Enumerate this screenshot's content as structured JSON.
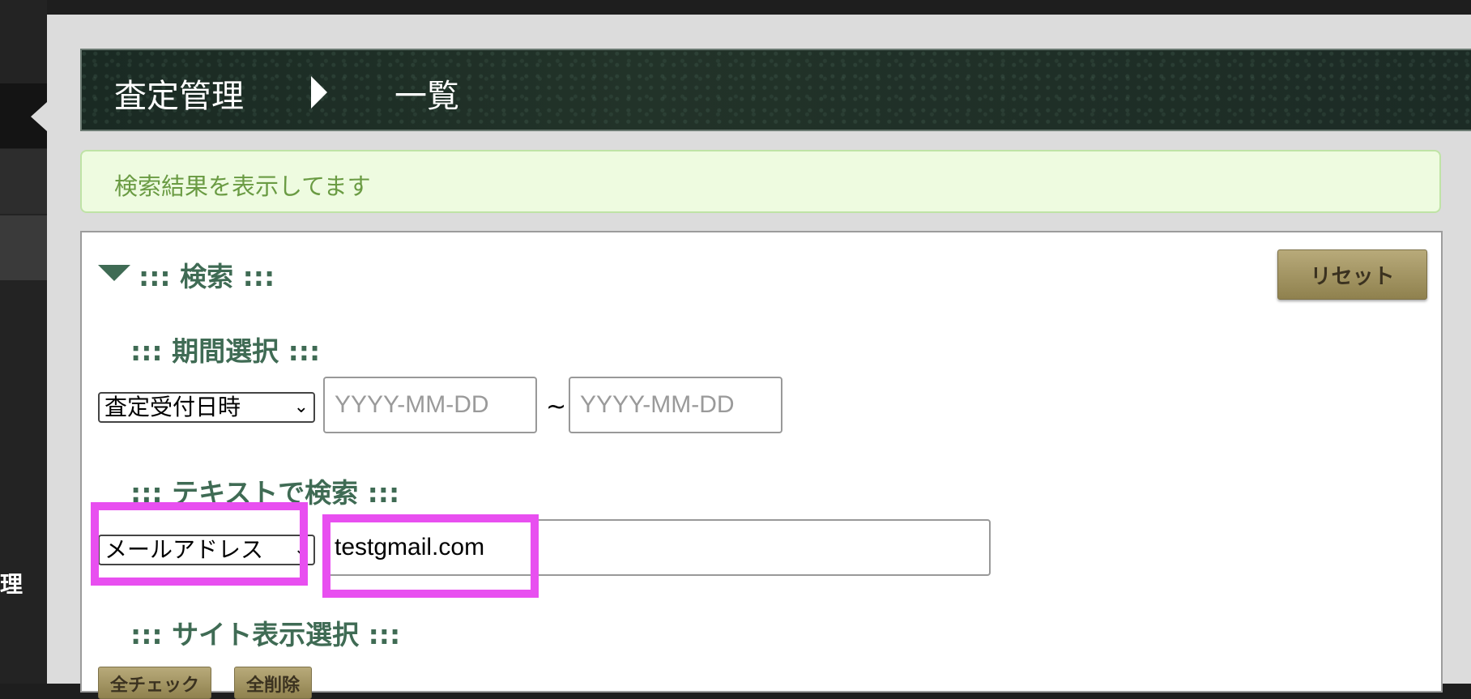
{
  "sidebar": {
    "partial_label": "理"
  },
  "header": {
    "title": "査定管理",
    "subtitle": "一覧"
  },
  "message": {
    "text": "検索結果を表示してます"
  },
  "search": {
    "title": "::: 検索 :::",
    "reset_label": "リセット",
    "period": {
      "title": "::: 期間選択 :::",
      "date_type_selected": "査定受付日時",
      "from_placeholder": "YYYY-MM-DD",
      "separator": "~",
      "to_placeholder": "YYYY-MM-DD"
    },
    "text_search": {
      "title": "::: テキストで検索 :::",
      "field_selected": "メールアドレス",
      "value": "testgmail.com"
    },
    "site": {
      "title": "::: サイト表示選択 :::",
      "check_all_label": "全チェック",
      "clear_all_label": "全削除"
    }
  },
  "colors": {
    "highlight": "#e84ff0",
    "accent_green": "#3f6b54",
    "gold_button": "#a89a66"
  }
}
